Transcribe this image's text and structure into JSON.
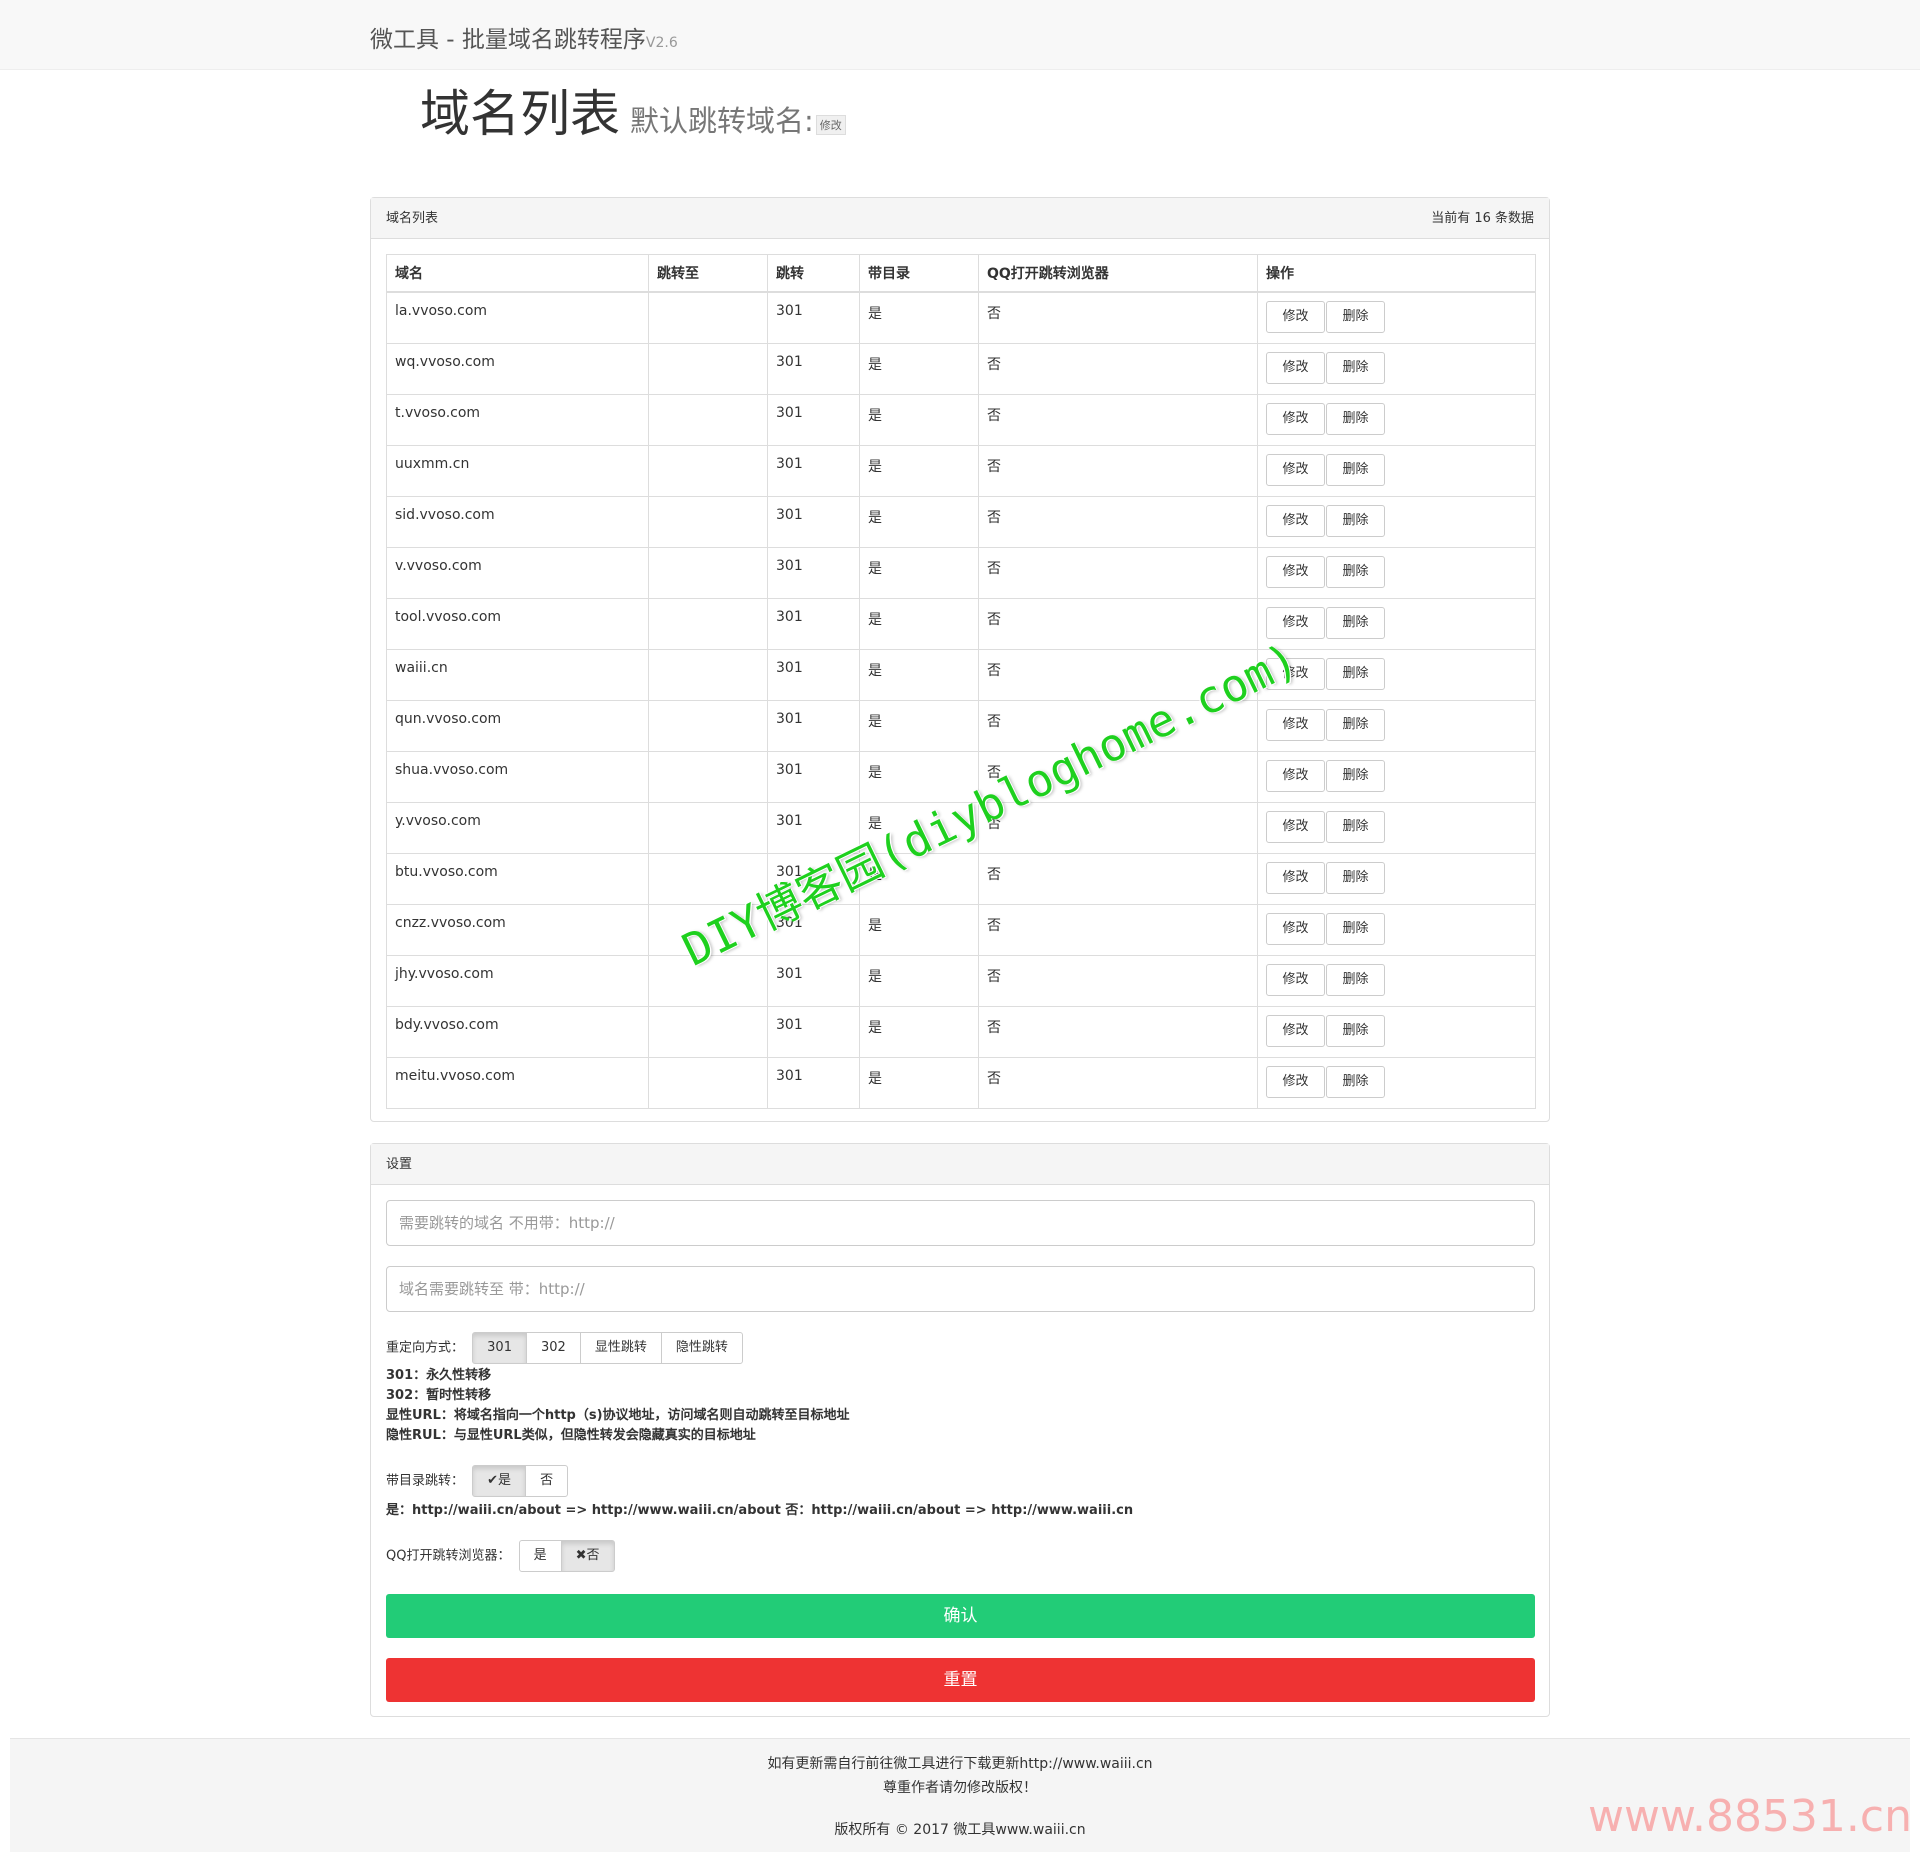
{
  "navbar": {
    "brand": "微工具 - 批量域名跳转程序",
    "version": "V2.6"
  },
  "header": {
    "title": "域名列表",
    "subtitle": "默认跳转域名:",
    "edit_label": "修改"
  },
  "list_panel": {
    "heading": "域名列表",
    "count_text": "当前有 16 条数据",
    "columns": [
      "域名",
      "跳转至",
      "跳转",
      "带目录",
      "QQ打开跳转浏览器",
      "操作"
    ],
    "edit_label": "修改",
    "delete_label": "删除",
    "rows": [
      {
        "domain": "la.vvoso.com",
        "target": "",
        "code": "301",
        "dir": "是",
        "qq": "否"
      },
      {
        "domain": "wq.vvoso.com",
        "target": "",
        "code": "301",
        "dir": "是",
        "qq": "否"
      },
      {
        "domain": "t.vvoso.com",
        "target": "",
        "code": "301",
        "dir": "是",
        "qq": "否"
      },
      {
        "domain": "uuxmm.cn",
        "target": "",
        "code": "301",
        "dir": "是",
        "qq": "否"
      },
      {
        "domain": "sid.vvoso.com",
        "target": "",
        "code": "301",
        "dir": "是",
        "qq": "否"
      },
      {
        "domain": "v.vvoso.com",
        "target": "",
        "code": "301",
        "dir": "是",
        "qq": "否"
      },
      {
        "domain": "tool.vvoso.com",
        "target": "",
        "code": "301",
        "dir": "是",
        "qq": "否"
      },
      {
        "domain": "waiii.cn",
        "target": "",
        "code": "301",
        "dir": "是",
        "qq": "否"
      },
      {
        "domain": "qun.vvoso.com",
        "target": "",
        "code": "301",
        "dir": "是",
        "qq": "否"
      },
      {
        "domain": "shua.vvoso.com",
        "target": "",
        "code": "301",
        "dir": "是",
        "qq": "否"
      },
      {
        "domain": "y.vvoso.com",
        "target": "",
        "code": "301",
        "dir": "是",
        "qq": "否"
      },
      {
        "domain": "btu.vvoso.com",
        "target": "",
        "code": "301",
        "dir": "是",
        "qq": "否"
      },
      {
        "domain": "cnzz.vvoso.com",
        "target": "",
        "code": "301",
        "dir": "是",
        "qq": "否"
      },
      {
        "domain": "jhy.vvoso.com",
        "target": "",
        "code": "301",
        "dir": "是",
        "qq": "否"
      },
      {
        "domain": "bdy.vvoso.com",
        "target": "",
        "code": "301",
        "dir": "是",
        "qq": "否"
      },
      {
        "domain": "meitu.vvoso.com",
        "target": "",
        "code": "301",
        "dir": "是",
        "qq": "否"
      }
    ]
  },
  "settings_panel": {
    "heading": "设置",
    "domain_placeholder": "需要跳转的域名 不用带：http://",
    "target_placeholder": "域名需要跳转至 带：http://",
    "redirect_label": "重定向方式：",
    "redirect_options": [
      "301",
      "302",
      "显性跳转",
      "隐性跳转"
    ],
    "help_lines": [
      "301：永久性转移",
      "302：暂时性转移",
      "显性URL：将域名指向一个http（s)协议地址，访问域名则自动跳转至目标地址",
      "隐性RUL：与显性URL类似，但隐性转发会隐藏真实的目标地址"
    ],
    "dir_label": "带目录跳转：",
    "dir_yes": "✔是",
    "dir_no": "否",
    "dir_example": "是：http://waiii.cn/about => http://www.waiii.cn/about 否：http://waiii.cn/about => http://www.waiii.cn",
    "qq_label": "QQ打开跳转浏览器：",
    "qq_yes": "是",
    "qq_no": "✖否",
    "confirm_label": "确认",
    "reset_label": "重置"
  },
  "footer": {
    "line1": "如有更新需自行前往微工具进行下载更新http://www.waiii.cn",
    "line2": "尊重作者请勿修改版权！",
    "line3": "版权所有 © 2017 微工具www.waiii.cn"
  },
  "watermarks": {
    "diagonal": "DIY博客园(diybloghome.com)",
    "corner": "www.88531.cn"
  },
  "colors": {
    "confirm": "#22cc77",
    "reset": "#ee3333",
    "watermark": "#1ed01e"
  }
}
